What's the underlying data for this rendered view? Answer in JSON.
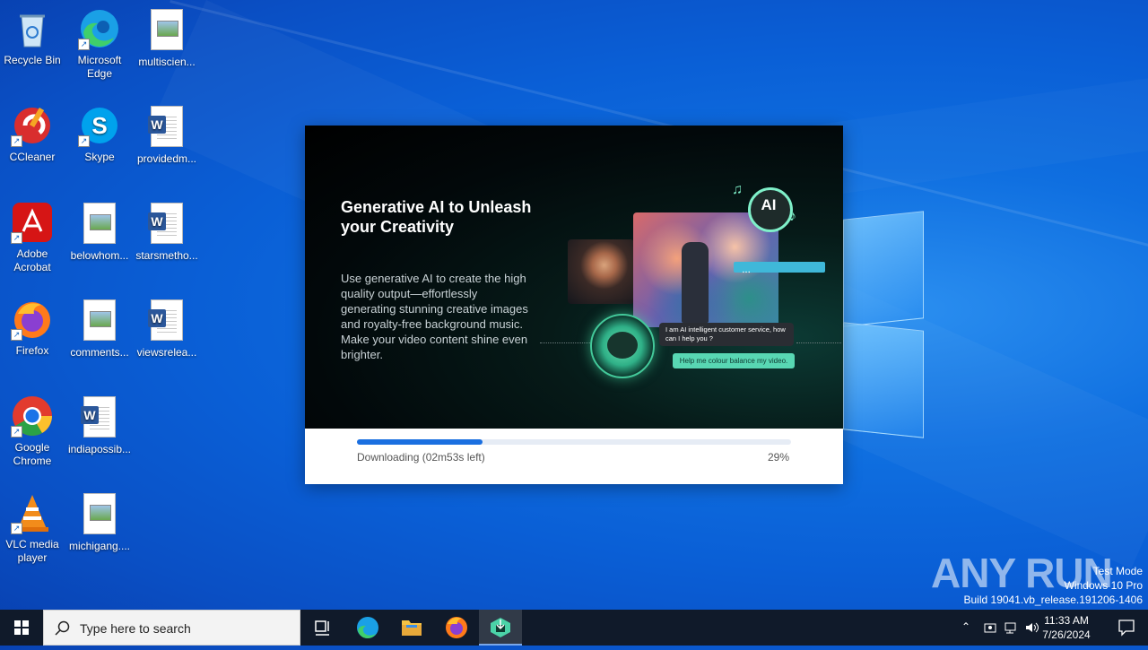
{
  "desktop_icons": [
    {
      "label": "Recycle Bin",
      "icon": "recycle-bin-icon"
    },
    {
      "label": "Microsoft Edge",
      "icon": "edge-icon"
    },
    {
      "label": "multiscien...",
      "icon": "image-file-icon"
    },
    {
      "label": "CCleaner",
      "icon": "ccleaner-icon"
    },
    {
      "label": "Skype",
      "icon": "skype-icon"
    },
    {
      "label": "providedm...",
      "icon": "word-doc-icon"
    },
    {
      "label": "Adobe Acrobat",
      "icon": "acrobat-icon"
    },
    {
      "label": "belowhom...",
      "icon": "image-file-icon"
    },
    {
      "label": "starsmetho...",
      "icon": "word-doc-icon"
    },
    {
      "label": "Firefox",
      "icon": "firefox-icon"
    },
    {
      "label": "comments...",
      "icon": "image-file-icon"
    },
    {
      "label": "viewsrelea...",
      "icon": "word-doc-icon"
    },
    {
      "label": "Google Chrome",
      "icon": "chrome-icon"
    },
    {
      "label": "indiapossib...",
      "icon": "word-doc-icon"
    },
    {
      "label": "VLC media player",
      "icon": "vlc-icon"
    },
    {
      "label": "michigang....",
      "icon": "image-file-icon"
    }
  ],
  "installer": {
    "headline": "Generative AI to Unleash your Creativity",
    "description": "Use generative AI to create the high quality output—effortlessly generating stunning creative images and royalty-free background music. Make your video content shine even brighter.",
    "ai_badge": "AI",
    "chat_reply": "I am AI intelligent customer service, how can I help you ?",
    "chat_prompt": "Help me colour balance my video.",
    "progress_label": "Downloading (02m53s left)",
    "progress_percent_text": "29%",
    "progress_value": 0.29
  },
  "watermark": {
    "brand": "ANY RUN",
    "line1": "Test Mode",
    "line2": "Windows 10 Pro",
    "line3": "Build 19041.vb_release.191206-1406"
  },
  "taskbar": {
    "search_placeholder": "Type here to search",
    "items": [
      "task-view-icon",
      "edge-icon",
      "file-explorer-icon",
      "firefox-icon",
      "installer-app-icon"
    ],
    "time": "11:33 AM",
    "date": "7/26/2024"
  }
}
